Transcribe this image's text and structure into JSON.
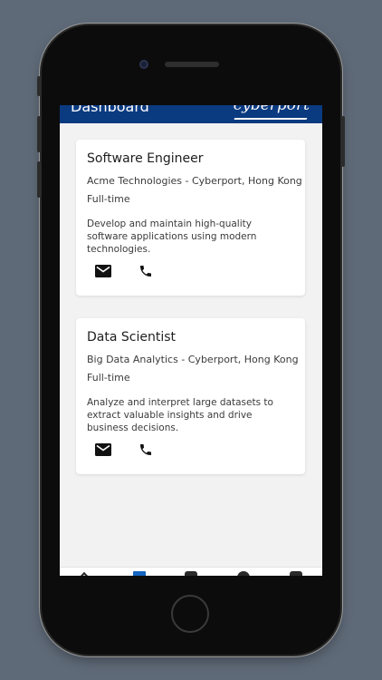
{
  "header": {
    "title": "Dashboard",
    "logo_text": "cyberport"
  },
  "jobs": [
    {
      "title": "Software Engineer",
      "company_location": "Acme Technologies - Cyberport, Hong Kong",
      "employment_type": "Full-time",
      "description": "Develop and maintain high-quality software applications using modern technologies."
    },
    {
      "title": "Data Scientist",
      "company_location": "Big Data Analytics - Cyberport, Hong Kong",
      "employment_type": "Full-time",
      "description": "Analyze and interpret large datasets to extract valuable insights and drive business decisions."
    }
  ],
  "card_actions": {
    "email_icon": "email-icon",
    "phone_icon": "phone-icon"
  },
  "bottom_nav": {
    "items": [
      "home-icon",
      "dashboard-icon",
      "calendar-icon",
      "profile-icon",
      "events-icon"
    ],
    "active_color": "#1565c0"
  },
  "colors": {
    "header_bg": "#0a3a80",
    "page_bg": "#5f6a78",
    "screen_bg": "#f2f2f2"
  }
}
